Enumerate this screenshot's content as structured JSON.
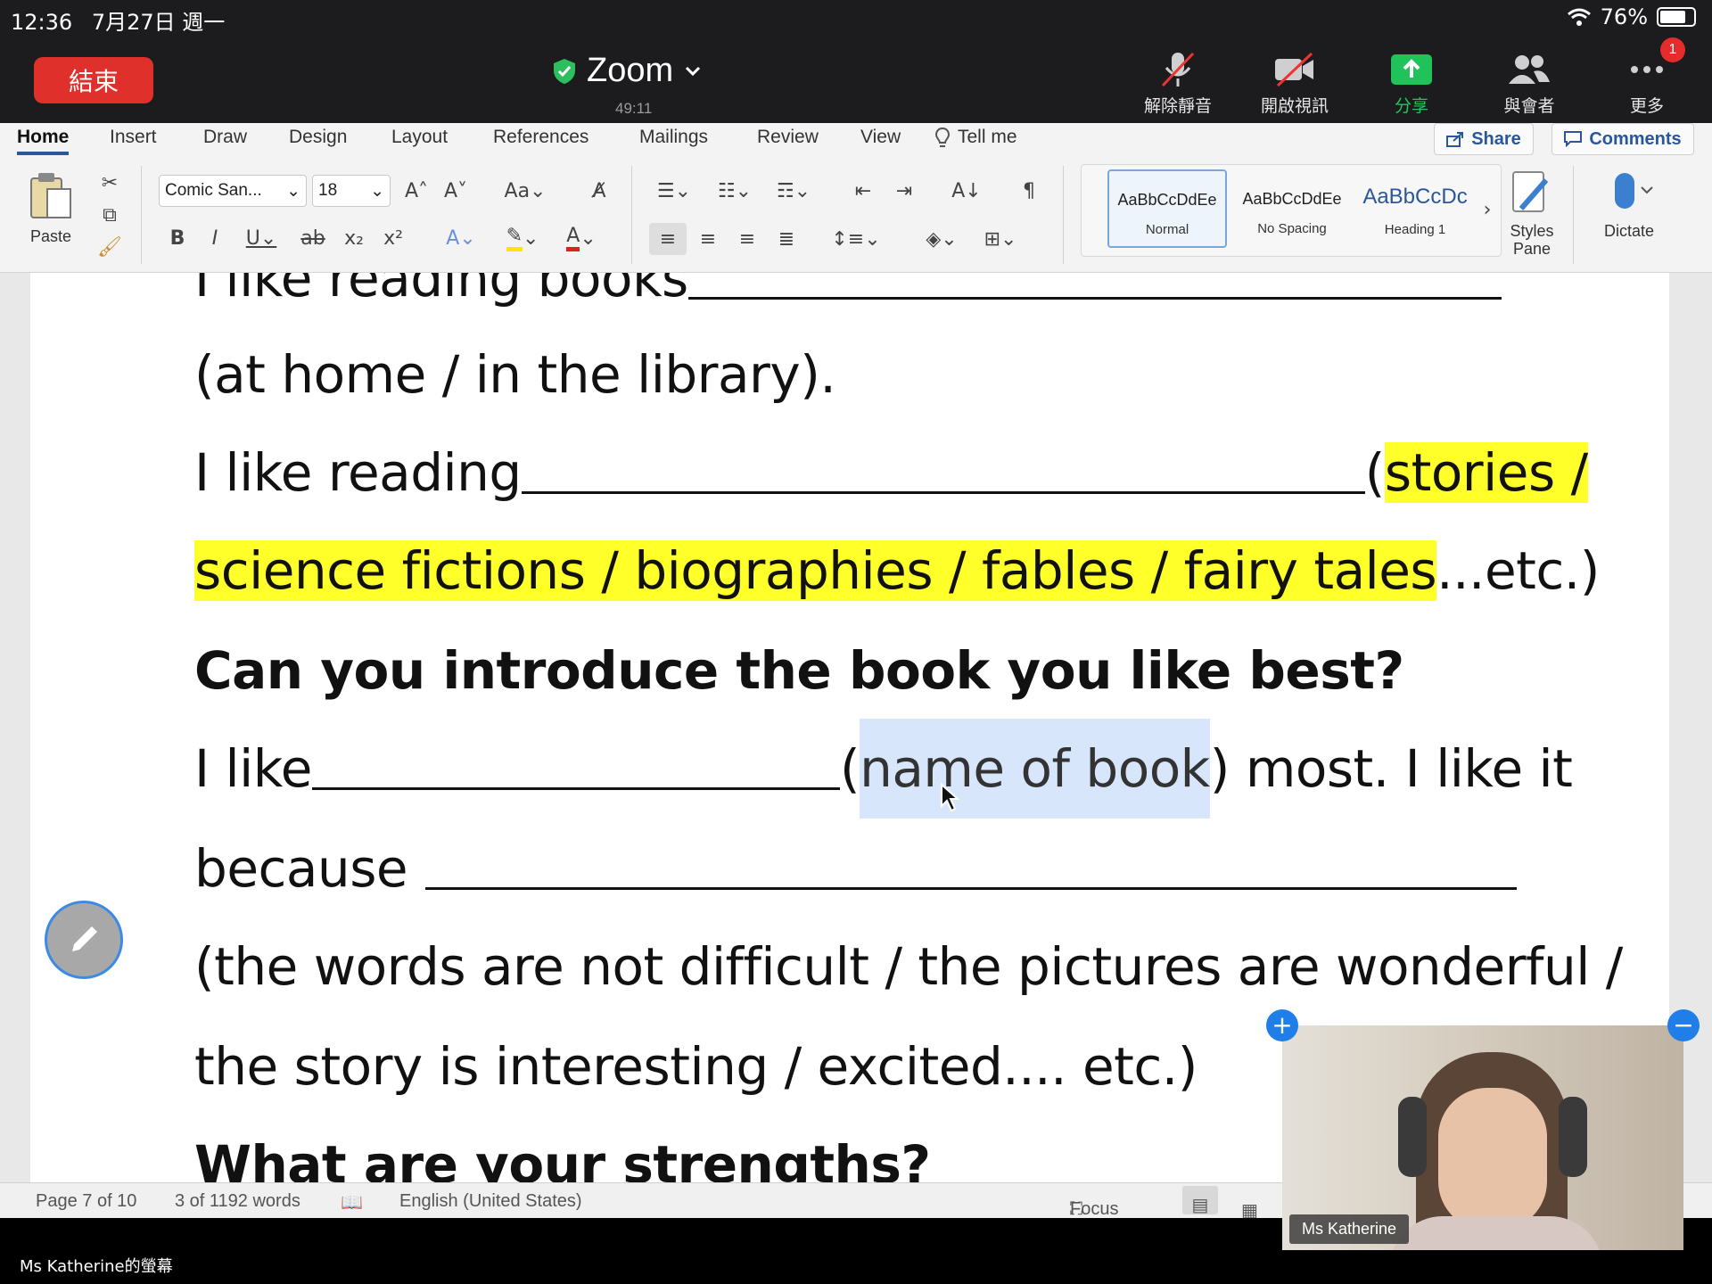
{
  "status_bar": {
    "time": "12:36",
    "date": "7月27日 週一",
    "battery": "76%"
  },
  "zoom": {
    "end_label": "結束",
    "title": "Zoom",
    "elapsed": "49:11",
    "toolbar": [
      {
        "label": "解除靜音",
        "icon": "mic-muted-icon"
      },
      {
        "label": "開啟視訊",
        "icon": "camera-off-icon"
      },
      {
        "label": "分享",
        "icon": "share-screen-icon"
      },
      {
        "label": "與會者",
        "icon": "participants-icon"
      },
      {
        "label": "更多",
        "icon": "more-icon",
        "badge": "1"
      }
    ],
    "colors": {
      "end": "#e0302c",
      "share": "#1fc35a",
      "badge": "#e52b2b"
    },
    "screen_share_label": "Ms Katherine的螢幕",
    "video_name": "Ms Katherine"
  },
  "word": {
    "tabs": [
      "Home",
      "Insert",
      "Draw",
      "Design",
      "Layout",
      "References",
      "Mailings",
      "Review",
      "View"
    ],
    "tell_me": "Tell me",
    "share_label": "Share",
    "comments_label": "Comments",
    "paste_label": "Paste",
    "font_name": "Comic San...",
    "font_size": "18",
    "styles": [
      "Normal",
      "No Spacing",
      "Heading 1"
    ],
    "style_preview": [
      "AaBbCcDdEe",
      "AaBbCcDdEe",
      "AaBbCcDc"
    ],
    "styles_pane_label": "Styles\nPane",
    "dictate_label": "Dictate",
    "accent": "#2b579a"
  },
  "document": {
    "l0": "I like reading books",
    "l1": "(at home / in the library).",
    "l2a": "I like reading",
    "l2b": "(",
    "l2c": "stories /",
    "l3a": "science fictions / biographies / fables / fairy tales",
    "l3b": "...etc.)",
    "l4": "Can you introduce the book you like best?",
    "l5a": "I like",
    "l5b": "(",
    "l5c": "name of book",
    "l5d": ") most. I like it",
    "l6": "because",
    "l7": "(the words are not difficult / the pictures are wonderful /",
    "l8": "the story is interesting / excited.... etc.)",
    "l9": "What are your strengths?"
  },
  "statusbar": {
    "page": "Page 7 of 10",
    "words": "3 of 1192 words",
    "language": "English (United States)",
    "focus": "Focus"
  }
}
